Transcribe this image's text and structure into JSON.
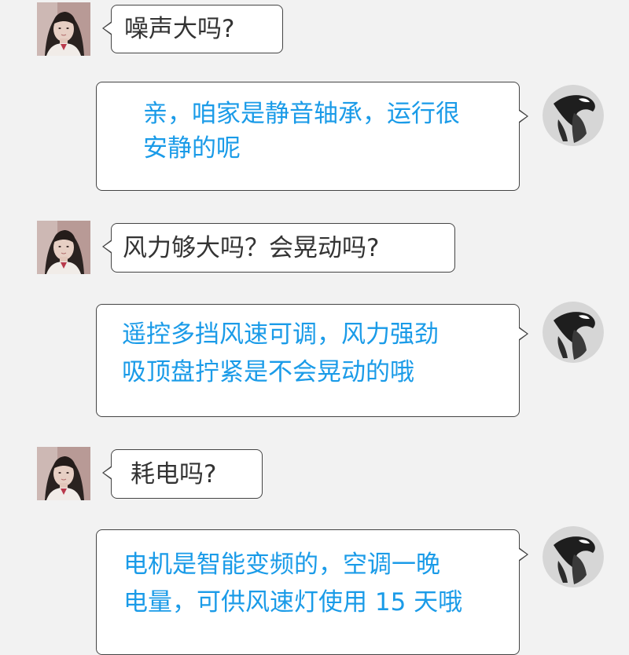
{
  "conversation": {
    "messages": [
      {
        "sender": "customer",
        "avatar_icon": "girl-portrait-avatar",
        "text": "噪声大吗?"
      },
      {
        "sender": "seller",
        "avatar_icon": "black-white-figure-avatar",
        "text": "亲，咱家是静音轴承，运行很\n安静的呢"
      },
      {
        "sender": "customer",
        "avatar_icon": "girl-portrait-avatar",
        "text": "风力够大吗？会晃动吗?"
      },
      {
        "sender": "seller",
        "avatar_icon": "black-white-figure-avatar",
        "text": "遥控多挡风速可调，风力强劲\n吸顶盘拧紧是不会晃动的哦"
      },
      {
        "sender": "customer",
        "avatar_icon": "girl-portrait-avatar",
        "text": "耗电吗?"
      },
      {
        "sender": "seller",
        "avatar_icon": "black-white-figure-avatar",
        "text": "电机是智能变频的，空调一晚\n电量，可供风速灯使用 15 天哦"
      }
    ]
  },
  "colors": {
    "background": "#f2f2f2",
    "bubble_fill": "#ffffff",
    "bubble_border": "#444444",
    "customer_text": "#333333",
    "seller_text": "#1a9be8"
  }
}
